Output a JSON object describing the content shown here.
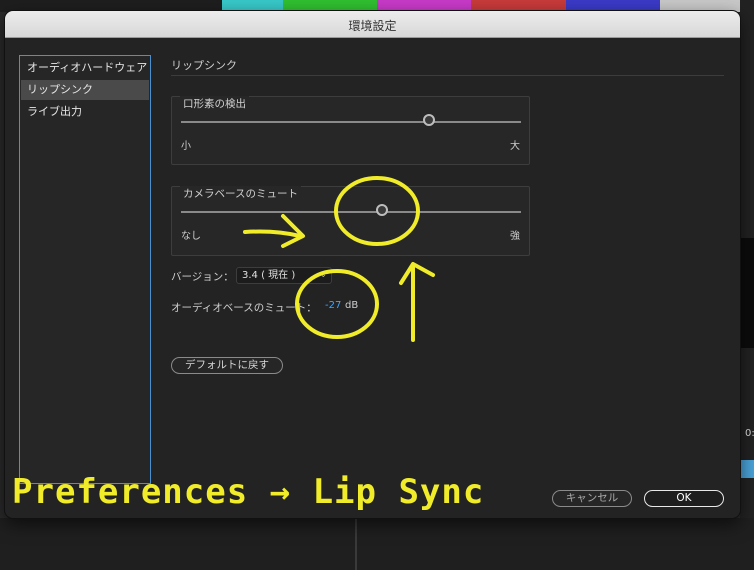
{
  "background": {
    "colorbars": [
      "#c8c8c8",
      "#d7d018",
      "#38c8c8",
      "#30c030",
      "#c83ac8",
      "#c83a3a",
      "#3a3ac8",
      "#c8c8c8"
    ],
    "right_edge_text": "0:"
  },
  "dialog": {
    "title": "環境設定",
    "sidebar": {
      "items": [
        {
          "label": "オーディオハードウェア",
          "selected": false
        },
        {
          "label": "リップシンク",
          "selected": true
        },
        {
          "label": "ライブ出力",
          "selected": false
        }
      ]
    },
    "section_title": "リップシンク",
    "viseme_detection": {
      "label": "口形素の検出",
      "min_label": "小",
      "max_label": "大",
      "value": 0.73
    },
    "camera_mute": {
      "label": "カメラベースのミュート",
      "min_label": "なし",
      "max_label": "強",
      "value": 0.59
    },
    "version": {
      "label": "バージョン：",
      "selected": "3.4 ( 現在 )"
    },
    "audio_mute": {
      "label": "オーディオベースのミュート：",
      "value": "-27",
      "unit": "dB"
    },
    "buttons": {
      "restore_defaults": "デフォルトに戻す",
      "cancel": "キャンセル",
      "ok": "OK"
    }
  },
  "annotation": {
    "caption": "Preferences → Lip Sync",
    "color": "#f0ec2a"
  }
}
